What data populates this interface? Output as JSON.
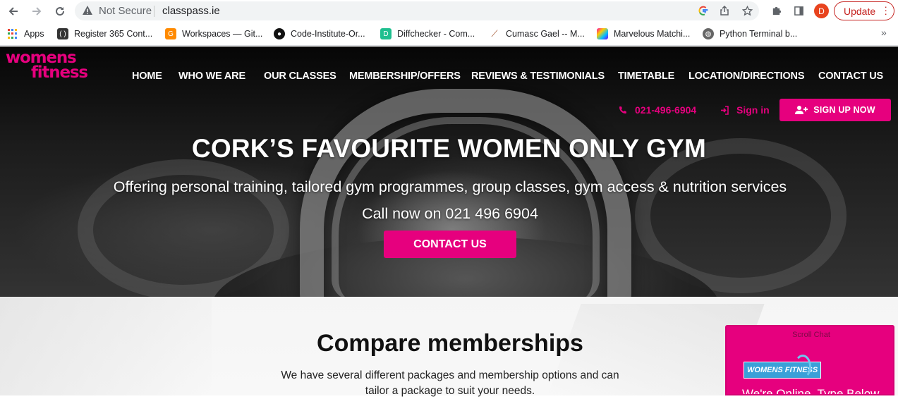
{
  "browser": {
    "security_label": "Not Secure",
    "url": "classpass.ie",
    "avatar_initial": "D",
    "update_label": "Update",
    "bookmarks": [
      {
        "label": "Apps",
        "icon": "apps-grid-icon"
      },
      {
        "label": "Register 365 Cont...",
        "icon": "bracket-icon"
      },
      {
        "label": "Workspaces — Git...",
        "icon": "gitpod-icon"
      },
      {
        "label": "Code-Institute-Or...",
        "icon": "github-icon"
      },
      {
        "label": "Diffchecker - Com...",
        "icon": "diffchecker-icon"
      },
      {
        "label": "Cumasc Gael -- M...",
        "icon": "guitar-icon"
      },
      {
        "label": "Marvelous Matchi...",
        "icon": "colorful-cube-icon"
      },
      {
        "label": "Python Terminal b...",
        "icon": "globe-icon"
      }
    ],
    "more_bookmarks": "»"
  },
  "site": {
    "logo_line1": "womens",
    "logo_line2": "fitness",
    "nav": [
      "HOME",
      "WHO WE ARE",
      "OUR CLASSES",
      "MEMBERSHIP/OFFERS",
      "REVIEWS & TESTIMONIALS",
      "TIMETABLE",
      "LOCATION/DIRECTIONS",
      "CONTACT US"
    ],
    "phone": "021-496-6904",
    "signin_label": "Sign in",
    "signup_label": "SIGN UP NOW",
    "brand_color": "#e6007e"
  },
  "hero": {
    "title": "CORK’S FAVOURITE WOMEN ONLY GYM",
    "subtitle": "Offering personal training, tailored gym programmes, group classes, gym access & nutrition services",
    "call_text": "Call now on 021 496 6904",
    "cta_label": "CONTACT US"
  },
  "compare": {
    "title": "Compare memberships",
    "text": "We have several different packages and membership options and can tailor a package to suit your needs."
  },
  "chat": {
    "header": "Scroll Chat",
    "logo_text": "WOMENS FITNESS",
    "message": "We're Online. Type Below"
  }
}
